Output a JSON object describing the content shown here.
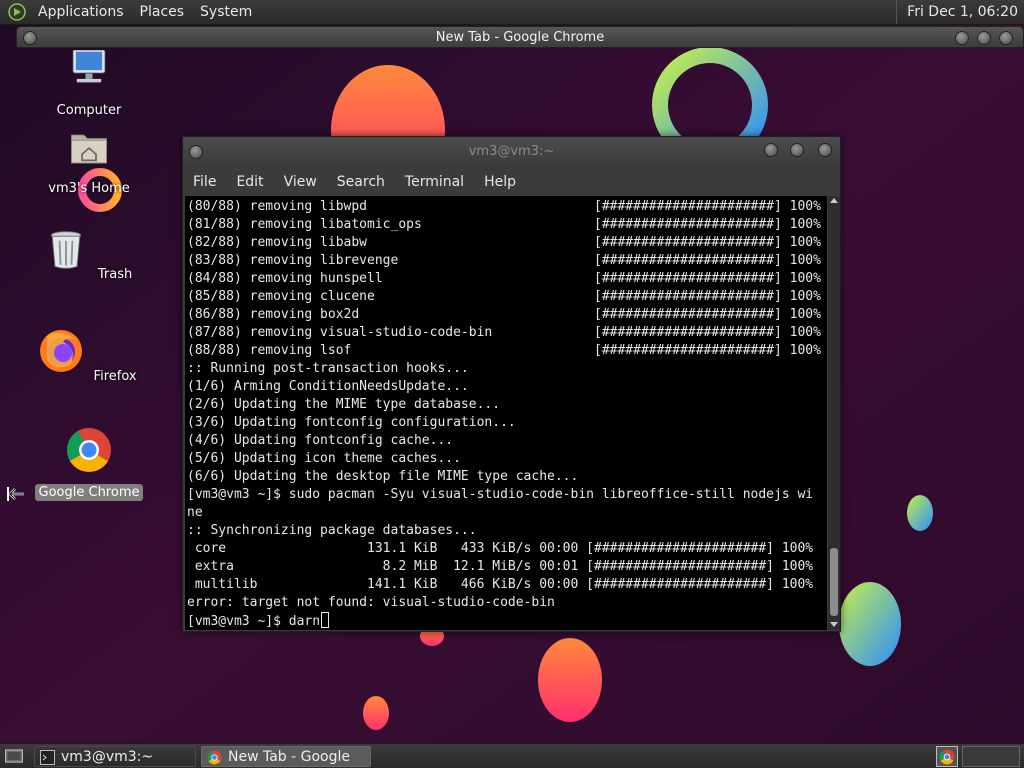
{
  "top_panel": {
    "menus": [
      "Applications",
      "Places",
      "System"
    ],
    "clock": "Fri Dec 1, 06:20"
  },
  "chrome_window": {
    "title": "New Tab - Google Chrome"
  },
  "desktop_icons": [
    {
      "label": "Computer",
      "icon": "computer-icon"
    },
    {
      "label": "vm3's Home",
      "icon": "home-folder-icon"
    },
    {
      "label": "Trash",
      "icon": "trash-icon"
    },
    {
      "label": "Firefox",
      "icon": "firefox-icon"
    },
    {
      "label": "Google Chrome",
      "icon": "chrome-icon",
      "selected": true
    }
  ],
  "terminal": {
    "title": "vm3@vm3:~",
    "menu": [
      "File",
      "Edit",
      "View",
      "Search",
      "Terminal",
      "Help"
    ],
    "lines": [
      "(80/88) removing libwpd                             [######################] 100%",
      "(81/88) removing libatomic_ops                      [######################] 100%",
      "(82/88) removing libabw                             [######################] 100%",
      "(83/88) removing librevenge                         [######################] 100%",
      "(84/88) removing hunspell                           [######################] 100%",
      "(85/88) removing clucene                            [######################] 100%",
      "(86/88) removing box2d                              [######################] 100%",
      "(87/88) removing visual-studio-code-bin             [######################] 100%",
      "(88/88) removing lsof                               [######################] 100%",
      ":: Running post-transaction hooks...",
      "(1/6) Arming ConditionNeedsUpdate...",
      "(2/6) Updating the MIME type database...",
      "(3/6) Updating fontconfig configuration...",
      "(4/6) Updating fontconfig cache...",
      "(5/6) Updating icon theme caches...",
      "(6/6) Updating the desktop file MIME type cache...",
      "[vm3@vm3 ~]$ sudo pacman -Syu visual-studio-code-bin libreoffice-still nodejs wi",
      "ne",
      ":: Synchronizing package databases...",
      " core                  131.1 KiB   433 KiB/s 00:00 [######################] 100%",
      " extra                   8.2 MiB  12.1 MiB/s 00:01 [######################] 100%",
      " multilib              141.1 KiB   466 KiB/s 00:00 [######################] 100%",
      "error: target not found: visual-studio-code-bin"
    ],
    "prompt": "[vm3@vm3 ~]$ ",
    "input": "darn"
  },
  "taskbar": {
    "tasks": [
      {
        "label": "vm3@vm3:~",
        "icon": "terminal-icon",
        "active": false
      },
      {
        "label": "New Tab - Google C...",
        "icon": "chrome-icon",
        "active": true
      }
    ]
  }
}
